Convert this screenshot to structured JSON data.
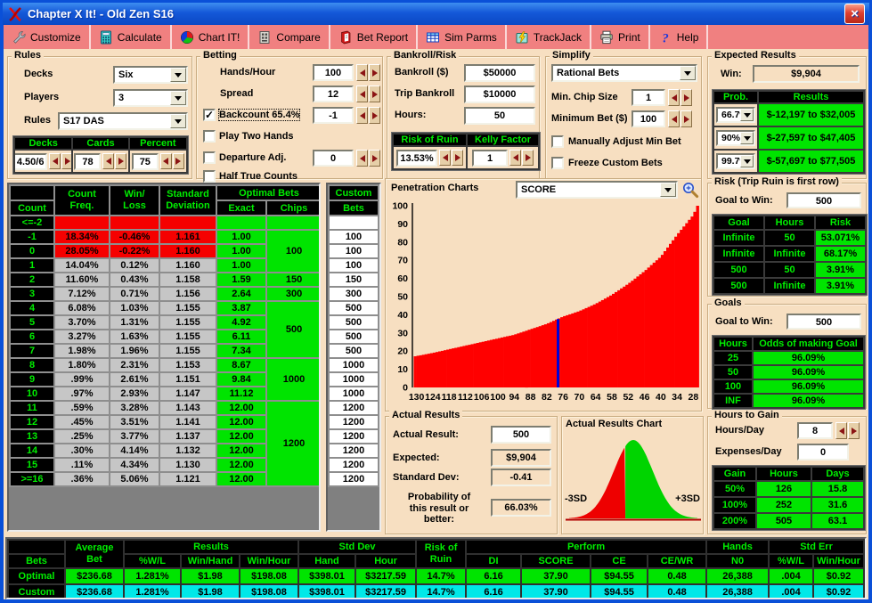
{
  "window": {
    "title": "Chapter X It! - Old Zen S16",
    "close_glyph": "×"
  },
  "toolbar": {
    "items": [
      {
        "label": "Customize",
        "icon": "wrench-icon"
      },
      {
        "label": "Calculate",
        "icon": "calculator-icon"
      },
      {
        "label": "Chart IT!",
        "icon": "pie-chart-icon"
      },
      {
        "label": "Compare",
        "icon": "compare-icon"
      },
      {
        "label": "Bet Report",
        "icon": "report-icon"
      },
      {
        "label": "Sim Parms",
        "icon": "grid-icon"
      },
      {
        "label": "TrackJack",
        "icon": "lightning-icon"
      },
      {
        "label": "Print",
        "icon": "printer-icon"
      },
      {
        "label": "Help",
        "icon": "help-icon"
      }
    ]
  },
  "rules": {
    "label": "Rules",
    "decks_label": "Decks",
    "decks_value": "Six",
    "players_label": "Players",
    "players_value": "3",
    "rules_label": "Rules",
    "rules_value": "S17 DAS",
    "table": {
      "headers": [
        "Decks",
        "Cards",
        "Percent"
      ],
      "values": [
        "4.50/6",
        "78",
        "75"
      ]
    }
  },
  "betting": {
    "label": "Betting",
    "hands_hour_label": "Hands/Hour",
    "hands_hour_value": "100",
    "spread_label": "Spread",
    "spread_value": "12",
    "backcount_label": "Backcount 65.4%",
    "backcount_value": "-1",
    "backcount_checked": "✓",
    "play_two_label": "Play Two Hands",
    "departure_label": "Departure Adj.",
    "departure_value": "0",
    "half_true_label": "Half True Counts"
  },
  "bankroll": {
    "label": "Bankroll/Risk",
    "bankroll_label": "Bankroll ($)",
    "bankroll_value": "$50000",
    "trip_label": "Trip Bankroll",
    "trip_value": "$10000",
    "hours_label": "Hours:",
    "hours_value": "50",
    "ror_header": "Risk of Ruin",
    "kelly_header": "Kelly Factor",
    "ror_value": "13.53%",
    "kelly_value": "1"
  },
  "simplify": {
    "label": "Simplify",
    "mode_value": "Rational Bets",
    "min_chip_label": "Min. Chip Size",
    "min_chip_value": "1",
    "min_bet_label": "Minimum Bet ($)",
    "min_bet_value": "100",
    "manual_label": "Manually Adjust Min Bet",
    "freeze_label": "Freeze Custom Bets"
  },
  "expected": {
    "label": "Expected Results",
    "win_label": "Win:",
    "win_value": "$9,904",
    "prob_header": "Prob.",
    "results_header": "Results",
    "rows": [
      {
        "prob": "66.7%",
        "result": "$-12,197 to $32,005"
      },
      {
        "prob": "90%",
        "result": "$-27,597 to $47,405"
      },
      {
        "prob": "99.7%",
        "result": "$-57,697 to $77,505"
      }
    ]
  },
  "count_table": {
    "h_count": "Count",
    "h_freq": "Count\nFreq.",
    "h_winloss": "Win/\nLoss",
    "h_sd": "Standard\nDeviation",
    "h_optimal": "Optimal Bets",
    "h_exact": "Exact",
    "h_chips": "Chips",
    "rows": [
      {
        "count": "<=-2",
        "freq": "",
        "wl": "",
        "sd": "",
        "exact": "",
        "neg": true
      },
      {
        "count": "-1",
        "freq": "18.34%",
        "wl": "-0.46%",
        "sd": "1.161",
        "exact": "1.00",
        "neg": true
      },
      {
        "count": "0",
        "freq": "28.05%",
        "wl": "-0.22%",
        "sd": "1.160",
        "exact": "1.00",
        "neg": true
      },
      {
        "count": "1",
        "freq": "14.04%",
        "wl": "0.12%",
        "sd": "1.160",
        "exact": "1.00",
        "neg": false
      },
      {
        "count": "2",
        "freq": "11.60%",
        "wl": "0.43%",
        "sd": "1.158",
        "exact": "1.59",
        "neg": false
      },
      {
        "count": "3",
        "freq": "7.12%",
        "wl": "0.71%",
        "sd": "1.156",
        "exact": "2.64",
        "neg": false
      },
      {
        "count": "4",
        "freq": "6.08%",
        "wl": "1.03%",
        "sd": "1.155",
        "exact": "3.87",
        "neg": false
      },
      {
        "count": "5",
        "freq": "3.70%",
        "wl": "1.31%",
        "sd": "1.155",
        "exact": "4.92",
        "neg": false
      },
      {
        "count": "6",
        "freq": "3.27%",
        "wl": "1.63%",
        "sd": "1.155",
        "exact": "6.11",
        "neg": false
      },
      {
        "count": "7",
        "freq": "1.98%",
        "wl": "1.96%",
        "sd": "1.155",
        "exact": "7.34",
        "neg": false
      },
      {
        "count": "8",
        "freq": "1.80%",
        "wl": "2.31%",
        "sd": "1.153",
        "exact": "8.67",
        "neg": false
      },
      {
        "count": "9",
        "freq": ".99%",
        "wl": "2.61%",
        "sd": "1.151",
        "exact": "9.84",
        "neg": false
      },
      {
        "count": "10",
        "freq": ".97%",
        "wl": "2.93%",
        "sd": "1.147",
        "exact": "11.12",
        "neg": false
      },
      {
        "count": "11",
        "freq": ".59%",
        "wl": "3.28%",
        "sd": "1.143",
        "exact": "12.00",
        "neg": false
      },
      {
        "count": "12",
        "freq": ".45%",
        "wl": "3.51%",
        "sd": "1.141",
        "exact": "12.00",
        "neg": false
      },
      {
        "count": "13",
        "freq": ".25%",
        "wl": "3.77%",
        "sd": "1.137",
        "exact": "12.00",
        "neg": false
      },
      {
        "count": "14",
        "freq": ".30%",
        "wl": "4.14%",
        "sd": "1.132",
        "exact": "12.00",
        "neg": false
      },
      {
        "count": "15",
        "freq": ".11%",
        "wl": "4.34%",
        "sd": "1.130",
        "exact": "12.00",
        "neg": false
      },
      {
        "count": ">=16",
        "freq": ".36%",
        "wl": "5.06%",
        "sd": "1.121",
        "exact": "12.00",
        "neg": false
      }
    ],
    "chips_groups": [
      {
        "span": 1,
        "value": ""
      },
      {
        "span": 3,
        "value": "100"
      },
      {
        "span": 1,
        "value": "150"
      },
      {
        "span": 1,
        "value": "300"
      },
      {
        "span": 4,
        "value": "500"
      },
      {
        "span": 3,
        "value": "1000"
      },
      {
        "span": 6,
        "value": "1200"
      }
    ]
  },
  "custom_bets": {
    "h1": "Custom",
    "h2": "Bets",
    "values": [
      "",
      "100",
      "100",
      "100",
      "150",
      "300",
      "500",
      "500",
      "500",
      "500",
      "1000",
      "1000",
      "1000",
      "1200",
      "1200",
      "1200",
      "1200",
      "1200",
      "1200"
    ]
  },
  "penetration": {
    "label": "Penetration Charts",
    "selector_value": "SCORE",
    "chart_data": {
      "type": "bar",
      "title": "Penetration Charts",
      "x_label_ticks": [
        130,
        124,
        118,
        112,
        106,
        100,
        94,
        88,
        82,
        76,
        70,
        64,
        58,
        52,
        46,
        40,
        34,
        28
      ],
      "ylim": [
        0,
        100
      ],
      "y_tick_step": 10,
      "bar_color": "#FF0000",
      "marker_color": "#0000D8",
      "marker_x": 78,
      "points": [
        [
          131,
          17
        ],
        [
          124,
          19
        ],
        [
          118,
          21
        ],
        [
          112,
          23
        ],
        [
          106,
          25
        ],
        [
          100,
          27
        ],
        [
          94,
          29
        ],
        [
          88,
          32
        ],
        [
          82,
          35
        ],
        [
          76,
          39
        ],
        [
          70,
          42
        ],
        [
          64,
          46
        ],
        [
          58,
          51
        ],
        [
          52,
          57
        ],
        [
          46,
          64
        ],
        [
          40,
          72
        ],
        [
          34,
          84
        ],
        [
          28,
          95
        ],
        [
          26.5,
          100
        ]
      ]
    }
  },
  "risk": {
    "label": "Risk (Trip Ruin is first row)",
    "goal_label": "Goal to Win:",
    "goal_value": "500",
    "headers": [
      "Goal",
      "Hours",
      "Risk"
    ],
    "rows": [
      [
        "Infinite",
        "50",
        "53.071%"
      ],
      [
        "Infinite",
        "Infinite",
        "68.17%"
      ],
      [
        "500",
        "50",
        "3.91%"
      ],
      [
        "500",
        "Infinite",
        "3.91%"
      ]
    ]
  },
  "goals": {
    "label": "Goals",
    "goal_label": "Goal to Win:",
    "goal_value": "500",
    "headers": [
      "Hours",
      "Odds of making Goal"
    ],
    "rows": [
      [
        "25",
        "96.09%"
      ],
      [
        "50",
        "96.09%"
      ],
      [
        "100",
        "96.09%"
      ],
      [
        "INF",
        "96.09%"
      ]
    ]
  },
  "hours_to_gain": {
    "label": "Hours to Gain",
    "hours_day_label": "Hours/Day",
    "hours_day_value": "8",
    "expenses_label": "Expenses/Day",
    "expenses_value": "0",
    "headers": [
      "Gain",
      "Hours",
      "Days"
    ],
    "rows": [
      [
        "50%",
        "126",
        "15.8"
      ],
      [
        "100%",
        "252",
        "31.6"
      ],
      [
        "200%",
        "505",
        "63.1"
      ]
    ]
  },
  "actual": {
    "label": "Actual Results",
    "result_label": "Actual Result:",
    "result_value": "500",
    "expected_label": "Expected:",
    "expected_value": "$9,904",
    "sd_label": "Standard Dev:",
    "sd_value": "-0.41",
    "prob_label": "Probability of\nthis result or\nbetter:",
    "prob_value": "66.03%"
  },
  "actual_chart": {
    "label": "Actual Results Chart",
    "left_label": "-3SD",
    "right_label": "+3SD",
    "chart_data": {
      "type": "area",
      "curve": "normal",
      "sd_range": [
        -3.3,
        3.3
      ],
      "split_sd": -0.41,
      "left_color": "#EE0000",
      "right_color": "#00D400"
    }
  },
  "bottom_table": {
    "row1": [
      {
        "t": "",
        "cs": 1,
        "rs": 1
      },
      {
        "t": "Average\nBet",
        "cs": 1,
        "rs": 2
      },
      {
        "t": "Results",
        "cs": 3,
        "rs": 1
      },
      {
        "t": "Std Dev",
        "cs": 2,
        "rs": 1
      },
      {
        "t": "Risk of\nRuin",
        "cs": 1,
        "rs": 2
      },
      {
        "t": "Perform",
        "cs": 4,
        "rs": 1
      },
      {
        "t": "Hands",
        "cs": 1,
        "rs": 1
      },
      {
        "t": "Std Err",
        "cs": 2,
        "rs": 1
      }
    ],
    "row2": [
      "Bets",
      "%W/L",
      "Win/Hand",
      "Win/Hour",
      "Hand",
      "Hour",
      "DI",
      "SCORE",
      "CE",
      "CE/WR",
      "N0",
      "%W/L",
      "Win/Hour"
    ],
    "rows": [
      {
        "name": "Optimal",
        "style": "lime",
        "values": [
          "$236.68",
          "1.281%",
          "$1.98",
          "$198.08",
          "$398.01",
          "$3217.59",
          "14.7%",
          "6.16",
          "37.90",
          "$94.55",
          "0.48",
          "26,388",
          ".004",
          "$0.92"
        ]
      },
      {
        "name": "Custom",
        "style": "cyan",
        "values": [
          "$236.68",
          "1.281%",
          "$1.98",
          "$198.08",
          "$398.01",
          "$3217.59",
          "14.7%",
          "6.16",
          "37.90",
          "$94.55",
          "0.48",
          "26,388",
          ".004",
          "$0.92"
        ]
      }
    ]
  }
}
